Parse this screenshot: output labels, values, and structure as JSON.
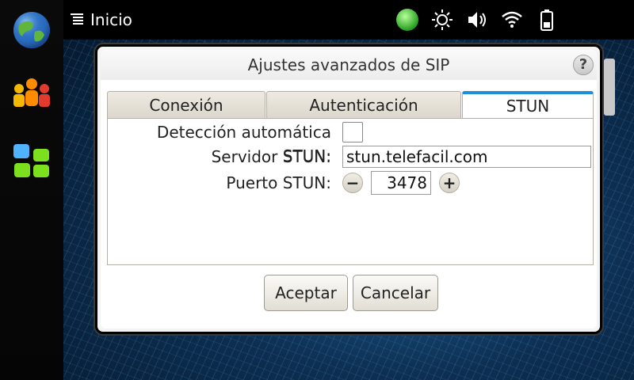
{
  "topbar": {
    "menu_title": "Inicio",
    "icons": [
      "presence-icon",
      "brightness-icon",
      "volume-icon",
      "wifi-icon",
      "battery-icon"
    ]
  },
  "launcher": {
    "icons": [
      "globe-icon",
      "contacts-icon",
      "apps-grid-icon"
    ]
  },
  "dialog": {
    "title": "Ajustes avanzados de SIP",
    "help_label": "?",
    "tabs": [
      {
        "label": "Conexión",
        "active": false
      },
      {
        "label": "Autenticación",
        "active": false
      },
      {
        "label": "STUN",
        "active": true
      }
    ],
    "fields": {
      "auto_detect_label": "Detección automática STUN:",
      "auto_detect_checked": false,
      "server_label": "Servidor STUN:",
      "server_value": "stun.telefacil.com",
      "port_label": "Puerto STUN:",
      "port_value": "3478",
      "decrement_label": "−",
      "increment_label": "+"
    },
    "buttons": {
      "accept": "Aceptar",
      "cancel": "Cancelar"
    }
  },
  "colors": {
    "accent": "#1e8fd6",
    "presence": "#37c02b"
  }
}
